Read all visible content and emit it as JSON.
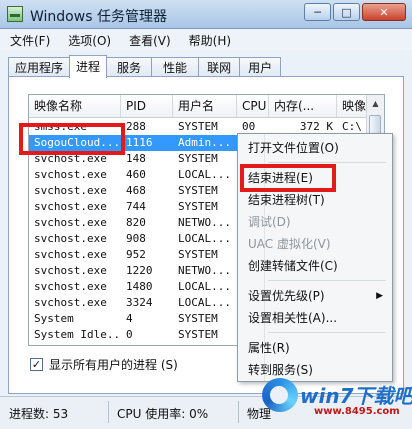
{
  "window": {
    "title": "Windows 任务管理器",
    "buttons": {
      "minimize": "─",
      "maximize": "□",
      "close": "✕"
    }
  },
  "menu": [
    "文件(F)",
    "选项(O)",
    "查看(V)",
    "帮助(H)"
  ],
  "tabs": [
    "应用程序",
    "进程",
    "服务",
    "性能",
    "联网",
    "用户"
  ],
  "active_tab": "进程",
  "table": {
    "columns": [
      "映像名称",
      "PID",
      "用户名",
      "CPU",
      "内存(...",
      "映像"
    ],
    "rows": [
      [
        "smss.exe",
        "288",
        "SYSTEM",
        "00",
        "372 K",
        "C:\\"
      ],
      [
        "SogouCloud...",
        "1116",
        "Admin...",
        "",
        "",
        ""
      ],
      [
        "svchost.exe",
        "148",
        "SYSTEM",
        "",
        "",
        ""
      ],
      [
        "svchost.exe",
        "460",
        "LOCAL...",
        "",
        "",
        ""
      ],
      [
        "svchost.exe",
        "468",
        "SYSTEM",
        "",
        "",
        ""
      ],
      [
        "svchost.exe",
        "744",
        "SYSTEM",
        "",
        "",
        ""
      ],
      [
        "svchost.exe",
        "820",
        "NETWO...",
        "",
        "",
        ""
      ],
      [
        "svchost.exe",
        "908",
        "LOCAL...",
        "",
        "",
        ""
      ],
      [
        "svchost.exe",
        "952",
        "SYSTEM",
        "",
        "",
        ""
      ],
      [
        "svchost.exe",
        "1220",
        "NETWO...",
        "",
        "",
        ""
      ],
      [
        "svchost.exe",
        "1480",
        "LOCAL...",
        "",
        "",
        ""
      ],
      [
        "svchost.exe",
        "3324",
        "LOCAL...",
        "",
        "",
        ""
      ],
      [
        "System",
        "4",
        "SYSTEM",
        "",
        "",
        ""
      ],
      [
        "System Idle...",
        "0",
        "SYSTEM",
        "",
        "",
        ""
      ]
    ],
    "selected_index": 1
  },
  "context_menu": {
    "items": [
      {
        "label": "打开文件位置(O)",
        "disabled": false
      },
      {
        "sep": true
      },
      {
        "label": "结束进程(E)",
        "disabled": false
      },
      {
        "label": "结束进程树(T)",
        "disabled": false
      },
      {
        "label": "调试(D)",
        "disabled": true
      },
      {
        "label": "UAC 虚拟化(V)",
        "disabled": true
      },
      {
        "label": "创建转储文件(C)",
        "disabled": false
      },
      {
        "sep": true
      },
      {
        "label": "设置优先级(P)",
        "disabled": false,
        "submenu": true
      },
      {
        "label": "设置相关性(A)...",
        "disabled": false
      },
      {
        "sep": true
      },
      {
        "label": "属性(R)",
        "disabled": false
      },
      {
        "label": "转到服务(S)",
        "disabled": false
      }
    ]
  },
  "checkbox": {
    "label": "显示所有用户的进程 (S)",
    "checked": true
  },
  "status": {
    "processes": "进程数: 53",
    "cpu": "CPU 使用率: 0%",
    "memory": "物理"
  },
  "watermark": {
    "brand": "win7下载吧",
    "url": "www.8495.com"
  },
  "colors": {
    "selection": "#3399ff",
    "highlight_box": "#e41919"
  }
}
